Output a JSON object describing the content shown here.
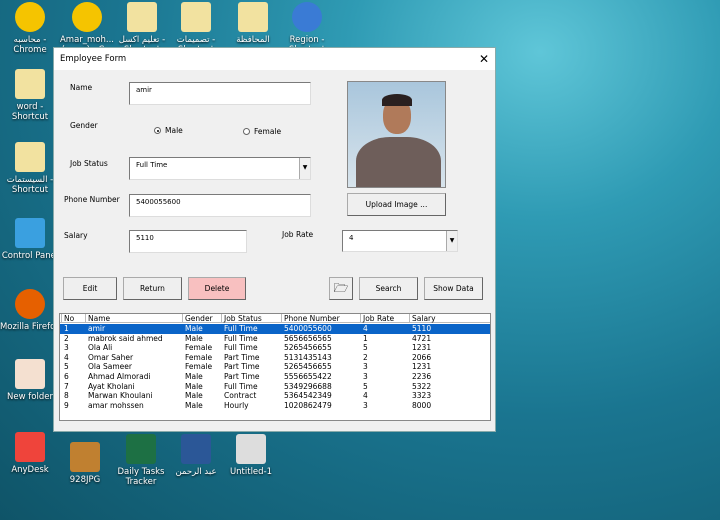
{
  "desktop_icons": [
    {
      "label": "محاسبه - Chrome",
      "icon": "chrome-icon",
      "color": "#f5c400"
    },
    {
      "label": "Amar_moh... (برمجة) - C...",
      "icon": "chrome-icon",
      "color": "#f5c400"
    },
    {
      "label": "تعليم اكسل - Shortcut",
      "icon": "folder-icon",
      "color": "#f2e2a0"
    },
    {
      "label": "تصميمات - Shortcut",
      "icon": "folder-icon",
      "color": "#f2e2a0"
    },
    {
      "label": "المحافظة",
      "icon": "folder-icon",
      "color": "#f2e2a0"
    },
    {
      "label": "Region - Shortcut",
      "icon": "clock-globe-icon",
      "color": "#3a7bd5"
    },
    {
      "label": "word - Shortcut",
      "icon": "folder-icon",
      "color": "#f2e2a0"
    },
    {
      "label": "السيستمات - Shortcut",
      "icon": "folder-icon",
      "color": "#f2e2a0"
    },
    {
      "label": "Control Panel",
      "icon": "control-panel-icon",
      "color": "#3aa0e0"
    },
    {
      "label": "Mozilla Firefox",
      "icon": "firefox-icon",
      "color": "#e66000"
    },
    {
      "label": "New folder",
      "icon": "pdf-folder-icon",
      "color": "#f4e0d0"
    },
    {
      "label": "AnyDesk",
      "icon": "anydesk-icon",
      "color": "#ef443b"
    },
    {
      "label": "928JPG",
      "icon": "image-icon",
      "color": "#c08030"
    },
    {
      "label": "Daily Tasks Tracker",
      "icon": "excel-icon",
      "color": "#1d7044"
    },
    {
      "label": "عبد الرحمن",
      "icon": "word-icon",
      "color": "#2b5797"
    },
    {
      "label": "Untitled-1",
      "icon": "image-icon",
      "color": "#ddd"
    }
  ],
  "form": {
    "title": "Employee Form",
    "name_label": "Name",
    "name_value": "amir",
    "gender_label": "Gender",
    "gender_options": [
      "Male",
      "Female"
    ],
    "gender_selected": "Male",
    "job_status_label": "Job Status",
    "job_status_value": "Full Time",
    "phone_label": "Phone Number",
    "phone_value": "5400055600",
    "salary_label": "Salary",
    "salary_value": "5110",
    "job_rate_label": "Job Rate",
    "job_rate_value": "4",
    "upload_label": "Upload Image ...",
    "buttons": {
      "edit": "Edit",
      "return": "Return",
      "delete": "Delete",
      "search": "Search",
      "show": "Show Data"
    },
    "delete_color": "#f8c0c0"
  },
  "table": {
    "headers": [
      "No",
      "Name",
      "Gender",
      "Job Status",
      "Phone Number",
      "Job Rate",
      "Salary"
    ],
    "rows": [
      [
        "1",
        "amir",
        "Male",
        "Full Time",
        "5400055600",
        "4",
        "5110"
      ],
      [
        "2",
        "mabrok said ahmed",
        "Male",
        "Full Time",
        "5656656565",
        "1",
        "4721"
      ],
      [
        "3",
        "Ola Ali",
        "Female",
        "Full Time",
        "5265456655",
        "5",
        "1231"
      ],
      [
        "4",
        "Omar Saher",
        "Female",
        "Part Time",
        "5131435143",
        "2",
        "2066"
      ],
      [
        "5",
        "Ola Sameer",
        "Female",
        "Part Time",
        "5265456655",
        "3",
        "1231"
      ],
      [
        "6",
        "Ahmad Almoradi",
        "Male",
        "Part Time",
        "5556655422",
        "3",
        "2236"
      ],
      [
        "7",
        "Ayat Kholani",
        "Male",
        "Full Time",
        "5349296688",
        "5",
        "5322"
      ],
      [
        "8",
        "Marwan Khoulani",
        "Male",
        "Contract",
        "5364542349",
        "4",
        "3323"
      ],
      [
        "9",
        "amar mohssen",
        "Male",
        "Hourly",
        "1020862479",
        "3",
        "8000"
      ]
    ],
    "selected_row": 0
  }
}
